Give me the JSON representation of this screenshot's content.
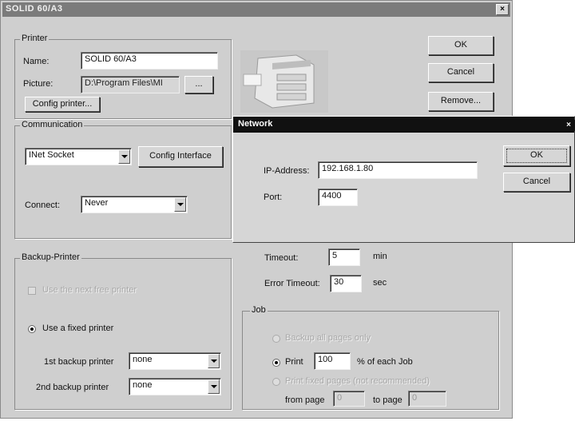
{
  "main_dialog": {
    "title": "SOLID 60/A3",
    "close": "×",
    "buttons": {
      "ok": "OK",
      "cancel": "Cancel",
      "remove": "Remove..."
    },
    "printer": {
      "group_label": "Printer",
      "name_label": "Name:",
      "name_value": "SOLID 60/A3",
      "picture_label": "Picture:",
      "picture_value": "D:\\Program Files\\MI",
      "browse_label": "...",
      "config_button": "Config printer..."
    },
    "communication": {
      "group_label": "Communication",
      "interface_value": "INet Socket",
      "config_interface": "Config Interface",
      "connect_label": "Connect:",
      "connect_value": "Never"
    },
    "backup": {
      "group_label": "Backup-Printer",
      "use_first_free": "Use the next free printer",
      "use_fixed": "Use a fixed printer",
      "first_label": "1st backup printer",
      "first_value": "none",
      "second_label": "2nd backup printer",
      "second_value": "none"
    },
    "timeouts": {
      "timeout_label": "Timeout:",
      "timeout_value": "5",
      "timeout_unit": "min",
      "error_label": "Error Timeout:",
      "error_value": "30",
      "error_unit": "sec"
    },
    "job": {
      "group_label": "Job",
      "option1": "Backup all pages only",
      "print_label": "Print",
      "print_value": "100",
      "print_suffix": "% of each Job",
      "option3": "Print fixed pages (not recommended)",
      "from_label": "from page",
      "from_value": "0",
      "to_label": "to page",
      "to_value": "0"
    }
  },
  "network_dialog": {
    "title": "Network",
    "close": "×",
    "ip_label": "IP-Address:",
    "ip_value": "192.168.1.80",
    "port_label": "Port:",
    "port_value": "4400",
    "ok": "OK",
    "cancel": "Cancel"
  },
  "icons": [
    "printer-image",
    "dropdown-arrow-icon",
    "close-icon"
  ]
}
